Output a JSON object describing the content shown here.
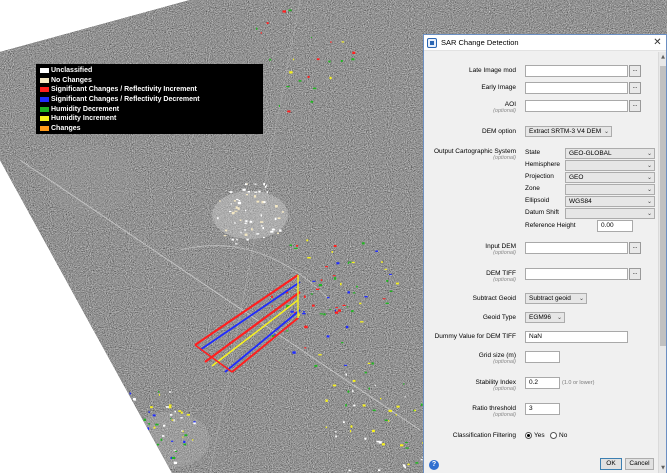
{
  "legend": {
    "items": [
      {
        "label": "Unclassified",
        "color": "#ffffff"
      },
      {
        "label": "No Changes",
        "color": "#f3e7c4"
      },
      {
        "label": "Significant Changes / Reflectivity Increment",
        "color": "#ff1f1f"
      },
      {
        "label": "Significant Changes / Reflectivity Decrement",
        "color": "#1f2bff"
      },
      {
        "label": "Humidity Decrement",
        "color": "#21b421"
      },
      {
        "label": "Humidity Increment",
        "color": "#f7f21e"
      },
      {
        "label": "Changes",
        "color": "#ff9a1a"
      }
    ]
  },
  "dialog": {
    "title": "SAR Change Detection",
    "close": "✕",
    "optional": "(optional)",
    "late_image": {
      "label": "Late Image mod",
      "value": ""
    },
    "early_image": {
      "label": "Early Image",
      "value": ""
    },
    "aoi": {
      "label": "AOI",
      "value": ""
    },
    "browse": "...",
    "dem_option": {
      "label": "DEM option",
      "value": "Extract SRTM-3 V4 DEM"
    },
    "ocs": {
      "label": "Output Cartographic System",
      "state": {
        "label": "State",
        "value": "GEO-GLOBAL"
      },
      "hemisphere": {
        "label": "Hemisphere",
        "value": ""
      },
      "projection": {
        "label": "Projection",
        "value": "GEO"
      },
      "zone": {
        "label": "Zone",
        "value": ""
      },
      "ellipsoid": {
        "label": "Ellipsoid",
        "value": "WGS84"
      },
      "datum_shift": {
        "label": "Datum Shift",
        "value": ""
      },
      "reference_height": {
        "label": "Reference Height",
        "value": "0.00"
      }
    },
    "input_dem": {
      "label": "Input DEM",
      "value": ""
    },
    "dem_tiff": {
      "label": "DEM TIFF",
      "value": ""
    },
    "subtract_geoid": {
      "label": "Subtract Geoid",
      "value": "Subtract geoid"
    },
    "geoid_type": {
      "label": "Geoid Type",
      "value": "EGM96"
    },
    "dummy_value": {
      "label": "Dummy Value for DEM TIFF",
      "value": "NaN"
    },
    "grid_size": {
      "label": "Grid size (m)",
      "value": ""
    },
    "stability_index": {
      "label": "Stability Index",
      "value": "0.2",
      "hint": "(1.0 or lower)"
    },
    "ratio_threshold": {
      "label": "Ratio threshold",
      "value": "3"
    },
    "classification_filtering": {
      "label": "Classification Filtering",
      "yes": "Yes",
      "no": "No",
      "selected": "Yes"
    },
    "ok": "OK",
    "cancel": "Cancel",
    "help": "?"
  }
}
